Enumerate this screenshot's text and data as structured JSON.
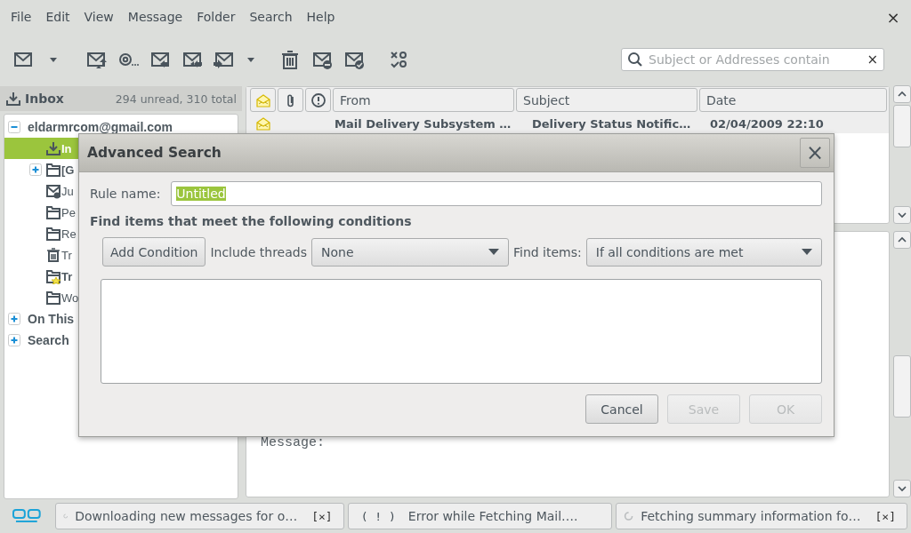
{
  "menu": [
    "File",
    "Edit",
    "View",
    "Message",
    "Folder",
    "Search",
    "Help"
  ],
  "window": {
    "close": "×"
  },
  "toolbar": {
    "groups": [
      [
        {
          "kind": "envelope"
        },
        {
          "kind": "caret"
        }
      ],
      [
        {
          "kind": "envelope-up"
        },
        {
          "kind": "at"
        },
        {
          "kind": "reply"
        },
        {
          "kind": "reply-all"
        },
        {
          "kind": "forward"
        },
        {
          "kind": "caret"
        }
      ],
      [
        {
          "kind": "trash"
        },
        {
          "kind": "envelope-minus"
        },
        {
          "kind": "envelope-check"
        }
      ],
      [
        {
          "kind": "xo"
        }
      ]
    ]
  },
  "search": {
    "placeholder": "Subject or Addresses contain",
    "clear": "×"
  },
  "folder_header": {
    "title": "Inbox",
    "counts": "294 unread, 310 total"
  },
  "tree": [
    {
      "label": "eldarmrcom@gmail.com",
      "expanded": true,
      "selected": false,
      "children": [
        {
          "label": "In",
          "kind": "inbox",
          "selected": true,
          "unread": true
        },
        {
          "label": "[G",
          "kind": "folder",
          "selected": false,
          "unread": true,
          "expanded": false
        },
        {
          "label": "Ju",
          "kind": "junk",
          "selected": false,
          "unread": false
        },
        {
          "label": "Pe",
          "kind": "folder",
          "selected": false,
          "unread": false
        },
        {
          "label": "Re",
          "kind": "folder",
          "selected": false,
          "unread": false
        },
        {
          "label": "Tr",
          "kind": "trash",
          "selected": false,
          "unread": false
        },
        {
          "label": "Tr",
          "kind": "starred",
          "selected": false,
          "unread": true
        },
        {
          "label": "Wo",
          "kind": "folder",
          "selected": false,
          "unread": false
        }
      ]
    },
    {
      "label": "On This",
      "expanded": false,
      "selected": false
    },
    {
      "label": "Search",
      "expanded": false,
      "selected": false
    }
  ],
  "message_list": {
    "columns": [
      {
        "kind": "read"
      },
      {
        "kind": "attachment"
      },
      {
        "kind": "priority"
      },
      {
        "kind": "text",
        "label": "From"
      },
      {
        "kind": "text",
        "label": "Subject"
      },
      {
        "kind": "text",
        "label": "Date"
      }
    ],
    "rows": [
      {
        "from": "Mail Delivery Subsystem …",
        "subject": "Delivery Status Notific…",
        "date": "02/04/2009 22:10",
        "unread": true
      }
    ]
  },
  "preview": {
    "text": "Message:"
  },
  "dialog": {
    "title": "Advanced Search",
    "close": "×",
    "rule_label": "Rule name:",
    "rule_value": "Untitled",
    "rule_value_selected": true,
    "heading": "Find items that meet the following conditions",
    "add_button": "Add Condition",
    "threads_label": "Include threads",
    "threads_value": "None",
    "find_label": "Find items:",
    "find_value": "If all conditions are met",
    "buttons": [
      {
        "label": "Cancel",
        "disabled": false
      },
      {
        "label": "Save",
        "disabled": true
      },
      {
        "label": "OK",
        "disabled": true
      }
    ]
  },
  "status_bar": {
    "tasks": [
      {
        "kind": "progress",
        "text": "Downloading new messages for o…",
        "close": "[×]"
      },
      {
        "kind": "error",
        "mark": "( ! )",
        "text": "Error while Fetching Mail…."
      },
      {
        "kind": "progress",
        "text": "Fetching summary information fo…",
        "close": "[×]"
      }
    ]
  }
}
